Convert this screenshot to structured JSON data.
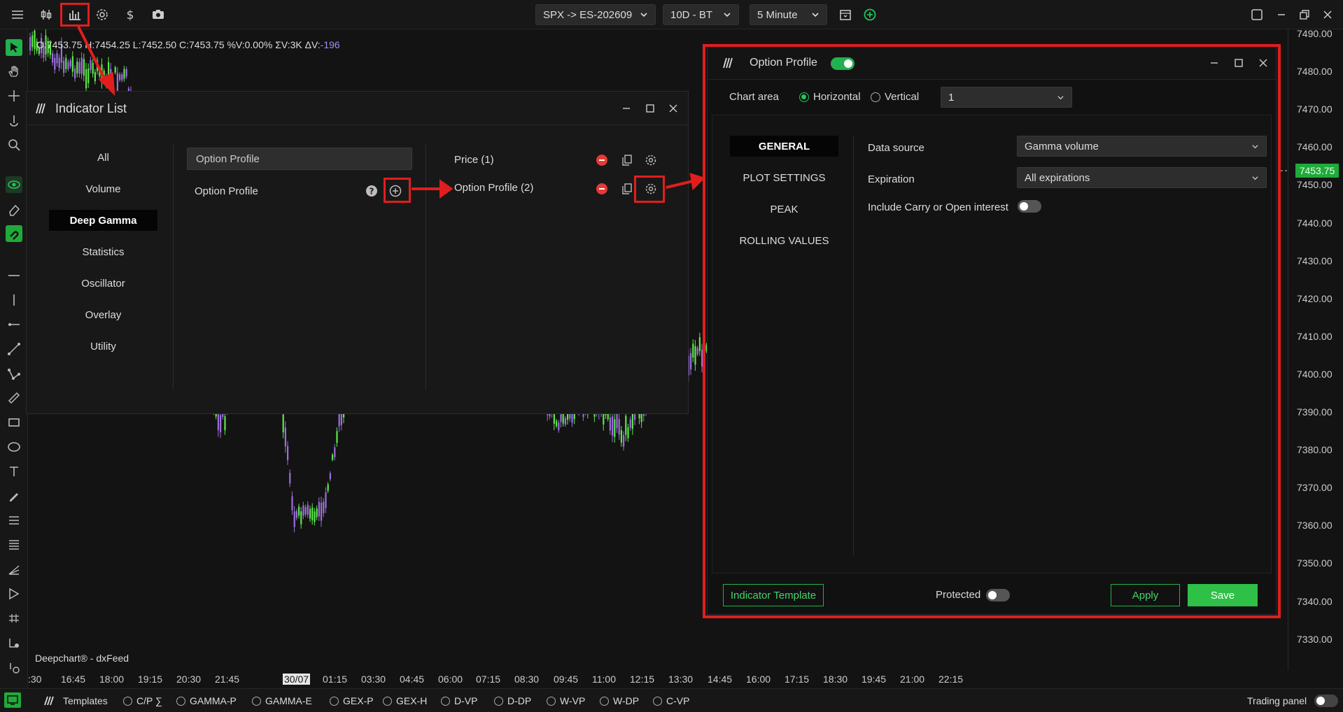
{
  "toolbar": {
    "symbol": "SPX -> ES-202609",
    "range": "10D - BT",
    "interval": "5 Minute"
  },
  "ohlc": {
    "open": "O:7453.75",
    "high": "H:7454.25",
    "low": "L:7452.50",
    "close": "C:7453.75",
    "volpct": "%V:0.00%",
    "sumvol": "ΣV:3K",
    "deltav_label": "ΔV:",
    "deltav_value": "-196"
  },
  "brand": "Deepchart® - dxFeed",
  "price_axis": [
    "7490.00",
    "7480.00",
    "7470.00",
    "7460.00",
    "7450.00",
    "7440.00",
    "7430.00",
    "7420.00",
    "7410.00",
    "7400.00",
    "7390.00",
    "7380.00",
    "7370.00",
    "7360.00",
    "7350.00",
    "7340.00",
    "7330.00"
  ],
  "current_price": "7453.75",
  "time_axis": [
    ":30",
    "16:45",
    "18:00",
    "19:15",
    "20:30",
    "21:45",
    "30/07",
    "01:15",
    "03:30",
    "04:45",
    "06:00",
    "07:15",
    "08:30",
    "09:45",
    "11:00",
    "12:15",
    "13:30",
    "14:45",
    "16:00",
    "17:15",
    "18:30",
    "19:45",
    "21:00",
    "22:15"
  ],
  "time_axis_selected": "30/07",
  "bottom": {
    "templates": "Templates",
    "items": [
      "C/P ∑",
      "GAMMA-P",
      "GAMMA-E",
      "GEX-P",
      "GEX-H",
      "D-VP",
      "D-DP",
      "W-VP",
      "W-DP",
      "C-VP"
    ],
    "trading_panel": "Trading panel"
  },
  "indicator_list": {
    "title": "Indicator List",
    "categories": [
      "All",
      "Volume",
      "Deep Gamma",
      "Statistics",
      "Oscillator",
      "Overlay",
      "Utility"
    ],
    "active_category": "Deep Gamma",
    "search_value": "Option Profile",
    "available": [
      "Option Profile"
    ],
    "applied": [
      "Price (1)",
      "Option Profile (2)"
    ]
  },
  "option_profile": {
    "title": "Option Profile",
    "enabled": true,
    "chart_area_label": "Chart area",
    "orientation_options": [
      "Horizontal",
      "Vertical"
    ],
    "orientation_selected": "Horizontal",
    "chart_area_value": "1",
    "tabs": [
      "GENERAL",
      "PLOT SETTINGS",
      "PEAK",
      "ROLLING VALUES"
    ],
    "active_tab": "GENERAL",
    "fields": {
      "data_source_label": "Data source",
      "data_source_value": "Gamma volume",
      "expiration_label": "Expiration",
      "expiration_value": "All expirations",
      "carry_label": "Include Carry or Open interest",
      "carry_enabled": false
    },
    "footer": {
      "template_button": "Indicator Template",
      "protected_label": "Protected",
      "protected_enabled": false,
      "apply": "Apply",
      "save": "Save"
    }
  },
  "colors": {
    "accent_green": "#22b14c",
    "annotation_red": "#e01e1e",
    "candle_up": "#5ee64a",
    "candle_down": "#9b6fdc"
  }
}
